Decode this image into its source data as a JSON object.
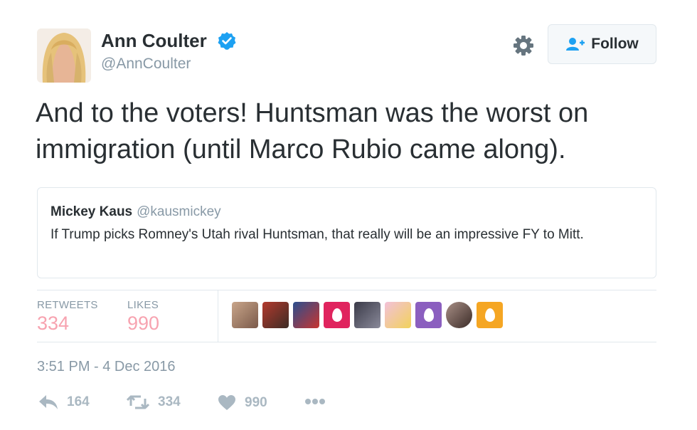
{
  "author": {
    "name": "Ann Coulter",
    "handle": "@AnnCoulter",
    "verified_icon": "verified-badge-icon",
    "avatar_icon": "avatar"
  },
  "header": {
    "settings_icon": "gear-icon",
    "follow_label": "Follow",
    "follow_icon": "add-user-icon"
  },
  "tweet": {
    "text": "And to the voters!  Huntsman was the worst on immigration (until Marco Rubio came along)."
  },
  "quoted_tweet": {
    "name": "Mickey Kaus",
    "handle": "@kausmickey",
    "text": "If Trump picks Romney's Utah rival Huntsman, that really will be an impressive FY to Mitt."
  },
  "stats": {
    "retweets_label": "RETWEETS",
    "retweets": "334",
    "likes_label": "LIKES",
    "likes": "990"
  },
  "likers": [
    {
      "kind": "photo",
      "colors": [
        "#c9a58a",
        "#7a5a4a"
      ]
    },
    {
      "kind": "photo",
      "colors": [
        "#b33a2e",
        "#3d2c25"
      ]
    },
    {
      "kind": "photo",
      "colors": [
        "#2a4f8f",
        "#c8342f"
      ]
    },
    {
      "kind": "egg",
      "colors": [
        "#e0245e"
      ]
    },
    {
      "kind": "photo",
      "colors": [
        "#3a3a48",
        "#8a8a9a"
      ]
    },
    {
      "kind": "photo",
      "colors": [
        "#f3c1d9",
        "#f1d25b"
      ]
    },
    {
      "kind": "egg",
      "colors": [
        "#8b5fbf"
      ]
    },
    {
      "kind": "round",
      "colors": [
        "#a88f86",
        "#3b2b27"
      ]
    },
    {
      "kind": "egg",
      "colors": [
        "#f5a623"
      ]
    }
  ],
  "timestamp": "3:51 PM - 4 Dec 2016",
  "actions": {
    "reply_icon": "reply-icon",
    "reply_count": "164",
    "retweet_icon": "retweet-icon",
    "retweet_count": "334",
    "like_icon": "heart-icon",
    "like_count": "990",
    "more_icon": "more-icon"
  },
  "colors": {
    "text": "#292f33",
    "secondary": "#8899a6",
    "verified": "#1da1f2",
    "stat_number": "#f7a3b0",
    "border": "#e1e8ed",
    "action": "#aab8c2"
  }
}
